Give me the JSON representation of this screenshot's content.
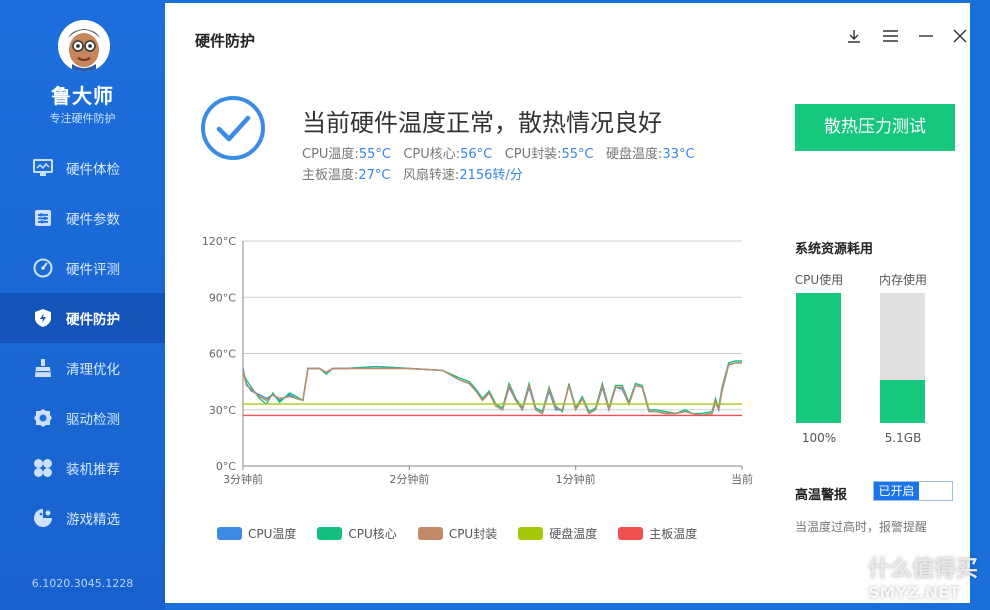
{
  "sidebar": {
    "app_name": "鲁大师",
    "app_sub": "专注硬件防护",
    "items": [
      {
        "label": "硬件体检",
        "icon": "monitor-icon"
      },
      {
        "label": "硬件参数",
        "icon": "sliders-icon"
      },
      {
        "label": "硬件评测",
        "icon": "gauge-icon"
      },
      {
        "label": "硬件防护",
        "icon": "shield-icon",
        "active": true
      },
      {
        "label": "清理优化",
        "icon": "broom-icon"
      },
      {
        "label": "驱动检测",
        "icon": "gear-icon"
      },
      {
        "label": "装机推荐",
        "icon": "grid-icon"
      },
      {
        "label": "游戏精选",
        "icon": "gamepad-icon"
      }
    ],
    "version": "6.1020.3045.1228"
  },
  "header": {
    "title": "硬件防护"
  },
  "status": {
    "headline": "当前硬件温度正常，散热情况良好",
    "temps_line1": [
      {
        "label": "CPU温度:",
        "value": "55°C"
      },
      {
        "label": "CPU核心:",
        "value": "56°C"
      },
      {
        "label": "CPU封装:",
        "value": "55°C"
      },
      {
        "label": "硬盘温度:",
        "value": "33°C"
      }
    ],
    "temps_line2": [
      {
        "label": "主板温度:",
        "value": "27°C"
      },
      {
        "label": "风扇转速:",
        "value": "2156转/分"
      }
    ],
    "stress_button": "散热压力测试"
  },
  "chart_data": {
    "type": "line",
    "x": [
      "3分钟前",
      "2分钟前",
      "1分钟前",
      "当前"
    ],
    "xlim": [
      -180,
      0
    ],
    "ylim": [
      0,
      120
    ],
    "yticks": [
      "0°C",
      "30°C",
      "60°C",
      "90°C",
      "120°C"
    ],
    "grid": true,
    "legend_position": "bottom",
    "series": [
      {
        "name": "CPU温度",
        "color": "#3b8ae6",
        "values": [
          [
            -180,
            52
          ],
          [
            -178,
            44
          ],
          [
            -175,
            40
          ],
          [
            -170,
            38
          ],
          [
            -166,
            36
          ],
          [
            -162,
            38
          ],
          [
            -158,
            35
          ],
          [
            -152,
            38
          ],
          [
            -148,
            36
          ],
          [
            -144,
            35
          ],
          [
            -141,
            52
          ],
          [
            -134,
            52
          ],
          [
            -130,
            50
          ],
          [
            -126,
            52
          ],
          [
            -118,
            52
          ],
          [
            -100,
            53
          ],
          [
            -80,
            52
          ],
          [
            -60,
            51
          ],
          [
            -50,
            46
          ],
          [
            -44,
            44
          ],
          [
            -40,
            40
          ],
          [
            -36,
            35
          ],
          [
            -32,
            39
          ],
          [
            -28,
            32
          ],
          [
            -24,
            30
          ],
          [
            -20,
            42
          ],
          [
            -16,
            35
          ],
          [
            -12,
            30
          ],
          [
            -8,
            42
          ],
          [
            -4,
            30
          ],
          [
            0,
            28
          ],
          [
            4,
            40
          ],
          [
            8,
            30
          ],
          [
            12,
            30
          ],
          [
            16,
            43
          ],
          [
            20,
            30
          ],
          [
            24,
            36
          ],
          [
            28,
            28
          ],
          [
            32,
            30
          ],
          [
            36,
            42
          ],
          [
            40,
            30
          ],
          [
            44,
            42
          ],
          [
            48,
            41
          ],
          [
            52,
            33
          ],
          [
            56,
            43
          ],
          [
            60,
            42
          ],
          [
            64,
            29
          ],
          [
            68,
            29
          ],
          [
            74,
            28
          ],
          [
            80,
            28
          ],
          [
            86,
            29
          ],
          [
            90,
            28
          ],
          [
            96,
            27
          ],
          [
            102,
            28
          ],
          [
            104,
            34
          ],
          [
            106,
            30
          ],
          [
            108,
            40
          ],
          [
            112,
            54
          ],
          [
            116,
            55
          ],
          [
            120,
            55
          ]
        ]
      },
      {
        "name": "CPU核心",
        "color": "#13c080",
        "values": [
          [
            -180,
            50
          ],
          [
            -178,
            46
          ],
          [
            -175,
            42
          ],
          [
            -170,
            36
          ],
          [
            -166,
            33
          ],
          [
            -162,
            39
          ],
          [
            -158,
            34
          ],
          [
            -152,
            39
          ],
          [
            -148,
            37
          ],
          [
            -144,
            35
          ],
          [
            -141,
            52
          ],
          [
            -134,
            52
          ],
          [
            -130,
            49
          ],
          [
            -126,
            52
          ],
          [
            -118,
            52
          ],
          [
            -100,
            53
          ],
          [
            -80,
            52
          ],
          [
            -60,
            51
          ],
          [
            -50,
            47
          ],
          [
            -44,
            45
          ],
          [
            -40,
            41
          ],
          [
            -36,
            36
          ],
          [
            -32,
            40
          ],
          [
            -28,
            33
          ],
          [
            -24,
            31
          ],
          [
            -20,
            44
          ],
          [
            -16,
            36
          ],
          [
            -12,
            31
          ],
          [
            -8,
            44
          ],
          [
            -4,
            31
          ],
          [
            0,
            29
          ],
          [
            4,
            42
          ],
          [
            8,
            32
          ],
          [
            12,
            29
          ],
          [
            16,
            44
          ],
          [
            20,
            31
          ],
          [
            24,
            37
          ],
          [
            28,
            29
          ],
          [
            32,
            31
          ],
          [
            36,
            44
          ],
          [
            40,
            31
          ],
          [
            44,
            43
          ],
          [
            48,
            43
          ],
          [
            52,
            34
          ],
          [
            56,
            44
          ],
          [
            60,
            43
          ],
          [
            64,
            30
          ],
          [
            68,
            30
          ],
          [
            74,
            29
          ],
          [
            80,
            28
          ],
          [
            86,
            30
          ],
          [
            90,
            28
          ],
          [
            96,
            28
          ],
          [
            102,
            29
          ],
          [
            104,
            36
          ],
          [
            106,
            31
          ],
          [
            108,
            42
          ],
          [
            112,
            55
          ],
          [
            116,
            56
          ],
          [
            120,
            56
          ]
        ]
      },
      {
        "name": "CPU封装",
        "color": "#c28a6a",
        "values": [
          [
            -180,
            51
          ],
          [
            -178,
            43
          ],
          [
            -175,
            41
          ],
          [
            -170,
            37
          ],
          [
            -166,
            35
          ],
          [
            -162,
            38
          ],
          [
            -158,
            36
          ],
          [
            -152,
            37
          ],
          [
            -148,
            36
          ],
          [
            -144,
            35
          ],
          [
            -141,
            52
          ],
          [
            -134,
            52
          ],
          [
            -130,
            50
          ],
          [
            -126,
            52
          ],
          [
            -118,
            52
          ],
          [
            -100,
            52
          ],
          [
            -80,
            52
          ],
          [
            -60,
            51
          ],
          [
            -50,
            46
          ],
          [
            -44,
            44
          ],
          [
            -40,
            40
          ],
          [
            -36,
            35
          ],
          [
            -32,
            39
          ],
          [
            -28,
            32
          ],
          [
            -24,
            30
          ],
          [
            -20,
            43
          ],
          [
            -16,
            35
          ],
          [
            -12,
            30
          ],
          [
            -8,
            43
          ],
          [
            -4,
            30
          ],
          [
            0,
            28
          ],
          [
            4,
            41
          ],
          [
            8,
            31
          ],
          [
            12,
            30
          ],
          [
            16,
            43
          ],
          [
            20,
            30
          ],
          [
            24,
            36
          ],
          [
            28,
            28
          ],
          [
            32,
            30
          ],
          [
            36,
            43
          ],
          [
            40,
            30
          ],
          [
            44,
            42
          ],
          [
            48,
            42
          ],
          [
            52,
            33
          ],
          [
            56,
            43
          ],
          [
            60,
            42
          ],
          [
            64,
            29
          ],
          [
            68,
            29
          ],
          [
            74,
            28
          ],
          [
            80,
            28
          ],
          [
            86,
            29
          ],
          [
            90,
            28
          ],
          [
            96,
            27
          ],
          [
            102,
            28
          ],
          [
            104,
            35
          ],
          [
            106,
            30
          ],
          [
            108,
            41
          ],
          [
            112,
            54
          ],
          [
            116,
            55
          ],
          [
            120,
            55
          ]
        ]
      },
      {
        "name": "硬盘温度",
        "color": "#a6c80a",
        "values": [
          [
            -180,
            33
          ],
          [
            120,
            33
          ]
        ]
      },
      {
        "name": "主板温度",
        "color": "#f05050",
        "values": [
          [
            -180,
            27
          ],
          [
            120,
            27
          ]
        ]
      }
    ]
  },
  "resources": {
    "title": "系统资源耗用",
    "cpu_label": "CPU使用",
    "cpu_value": "100%",
    "cpu_fraction": 1.0,
    "mem_label": "内存使用",
    "mem_value": "5.1GB",
    "mem_fraction": 0.33
  },
  "alarm": {
    "title": "高温警报",
    "toggle_label": "已开启",
    "desc": "当温度过高时，报警提醒"
  },
  "watermark": {
    "text": "什么值得买",
    "site": "SMYZ.NET"
  }
}
